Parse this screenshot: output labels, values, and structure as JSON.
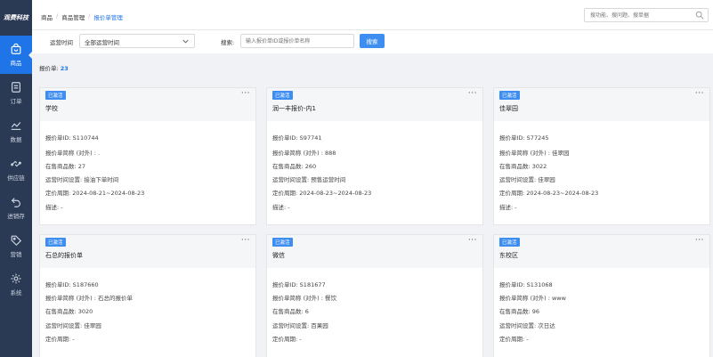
{
  "app": {
    "logo": "观费科技"
  },
  "sidebar": {
    "items": [
      {
        "label": "商品",
        "icon": "bag-icon",
        "active": true
      },
      {
        "label": "订单",
        "icon": "order-icon",
        "active": false
      },
      {
        "label": "数据",
        "icon": "chart-line-icon",
        "active": false
      },
      {
        "label": "供应链",
        "icon": "supply-chain-icon",
        "active": false
      },
      {
        "label": "进销存",
        "icon": "inventory-icon",
        "active": false
      },
      {
        "label": "营销",
        "icon": "tag-icon",
        "active": false
      },
      {
        "label": "系统",
        "icon": "gear-icon",
        "active": false
      }
    ]
  },
  "header": {
    "breadcrumb": [
      "商品",
      "商品管理",
      "报价单管理"
    ],
    "search_placeholder": "搜功能、搜问题、搜单据"
  },
  "filters": {
    "time_label": "运营时间",
    "time_value": "全部运营时间",
    "search_label": "搜索:",
    "search_placeholder": "输入报价单ID或报价单名称",
    "search_button": "搜索"
  },
  "summary": {
    "label": "报价单:",
    "count": "23"
  },
  "cards": [
    {
      "status": "已激活",
      "title": "学校",
      "fields": [
        "报价单ID: S110744",
        "报价单简称 (对外) : .",
        "在售商品数: 27",
        "运营时间设置: 接油下单时间",
        "定价周期: 2024-08-21~2024-08-23",
        "描述: -"
      ]
    },
    {
      "status": "已激活",
      "title": "润一丰报价-内1",
      "fields": [
        "报价单ID: S97741",
        "报价单简称 (对外) : 888",
        "在售商品数: 260",
        "运营时间设置: 预售运营时间",
        "定价周期: 2024-08-23~2024-08-23",
        "描述: -"
      ]
    },
    {
      "status": "已激活",
      "title": "佳翠园",
      "fields": [
        "报价单ID: S77245",
        "报价单简称 (对外) : 佳翠园",
        "在售商品数: 3022",
        "运营时间设置: 佳翠园",
        "定价周期: 2024-08-23~2024-08-23",
        "描述: -"
      ]
    },
    {
      "status": "已激活",
      "title": "石总的报价单",
      "fields": [
        "报价单ID: S187660",
        "报价单简称 (对外) : 石总的报价单",
        "在售商品数: 3020",
        "运营时间设置: 佳翠园",
        "定价周期: -"
      ]
    },
    {
      "status": "已激活",
      "title": "微信",
      "fields": [
        "报价单ID: S181677",
        "报价单简称 (对外) : 餐饮",
        "在售商品数: 6",
        "运营时间设置: 百果园",
        "定价周期: -"
      ]
    },
    {
      "status": "已激活",
      "title": "东校区",
      "fields": [
        "报价单ID: S131068",
        "报价单简称 (对外) : www",
        "在售商品数: 96",
        "运营时间设置: 次日达",
        "定价周期: -"
      ]
    }
  ]
}
